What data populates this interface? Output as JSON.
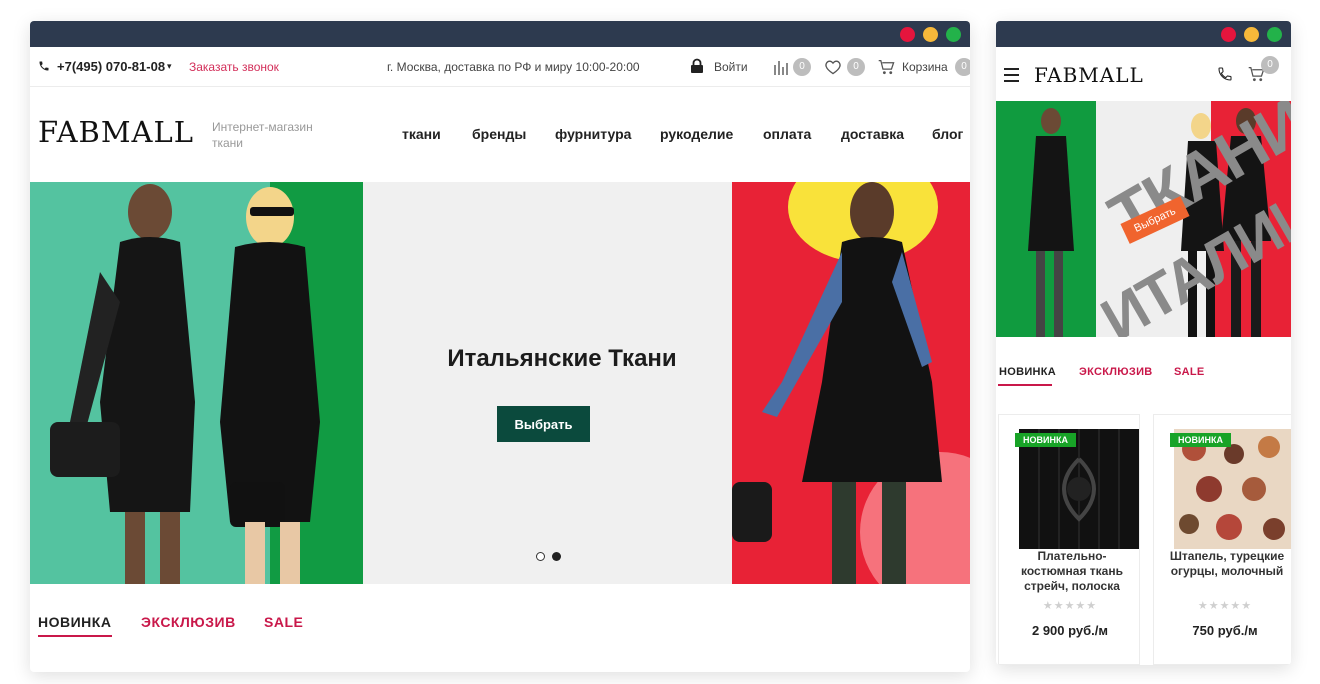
{
  "colors": {
    "titlebar": "#2d3a4f",
    "accent_pink": "#c9184a",
    "button_dark_green": "#0b4a3d",
    "new_badge_green": "#18a327"
  },
  "desktop": {
    "topbar": {
      "phone": "+7(495) 070-81-08",
      "phone_dropdown": "▾",
      "callback": "Заказать звонок",
      "delivery": "г. Москва, доставка по РФ и миру  10:00-20:00",
      "login": "Войти",
      "compare_count": "0",
      "favorites_count": "0",
      "cart_label": "Корзина",
      "cart_count": "0"
    },
    "header": {
      "logo": "FABMALL",
      "tagline": "Интернет-магазин ткани",
      "nav": [
        "ткани",
        "бренды",
        "фурнитура",
        "рукоделие",
        "оплата",
        "доставка",
        "блог"
      ]
    },
    "hero": {
      "title": "Итальянские Ткани",
      "button": "Выбрать"
    },
    "tabs": [
      "НОВИНКА",
      "ЭКСКЛЮЗИВ",
      "SALE"
    ]
  },
  "mobile": {
    "header": {
      "logo": "FABMALL",
      "cart_count": "0"
    },
    "hero": {
      "text_big": "ТКАНИ",
      "text_big2": "ИТАЛИИ",
      "button": "Выбрать"
    },
    "tabs": [
      "НОВИНКА",
      "ЭКСКЛЮЗИВ",
      "SALE"
    ],
    "products": [
      {
        "badge": "НОВИНКА",
        "title": "Платель­но-костюмная ткань стрейч, полоска",
        "stars": "★★★★★",
        "price": "2 900 руб./м"
      },
      {
        "badge": "НОВИНКА",
        "title": "Штапель, турецкие огурцы, молочный",
        "stars": "★★★★★",
        "price": "750 руб./м"
      }
    ]
  }
}
